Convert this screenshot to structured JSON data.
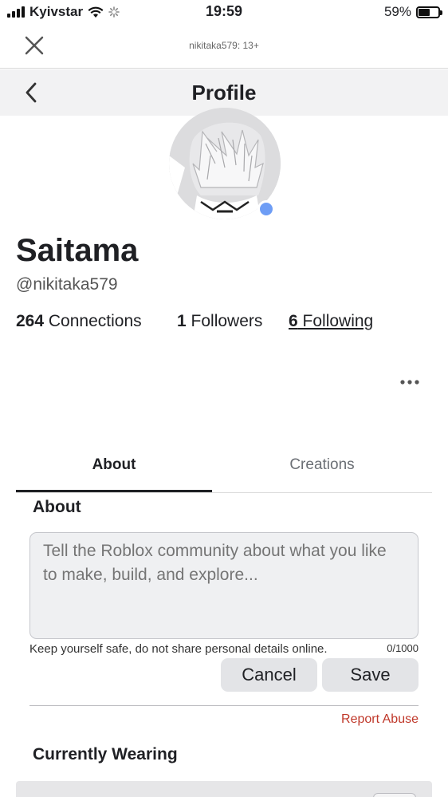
{
  "status_bar": {
    "carrier": "Kyivstar",
    "time": "19:59",
    "battery": "59%",
    "battery_level": 0.59
  },
  "browser": {
    "url_label": "nikitaka579: 13+"
  },
  "header": {
    "title": "Profile"
  },
  "profile": {
    "display_name": "Saitama",
    "username": "@nikitaka579",
    "connections_count": "264",
    "connections_label": " Connections",
    "followers_count": "1",
    "followers_label": " Followers",
    "following_count": "6",
    "following_label": " Following",
    "online_color": "#6e9df5"
  },
  "tabs": [
    {
      "label": "About",
      "active": true
    },
    {
      "label": "Creations",
      "active": false
    }
  ],
  "about": {
    "heading": "About",
    "placeholder": "Tell the Roblox community about what you like to make, build, and explore...",
    "value": "",
    "safety_note": "Keep yourself safe, do not share personal details online.",
    "char_count": "0/1000",
    "cancel_label": "Cancel",
    "save_label": "Save",
    "report_abuse": "Report Abuse",
    "report_color": "#c0392b"
  },
  "wearing": {
    "heading": "Currently Wearing"
  }
}
